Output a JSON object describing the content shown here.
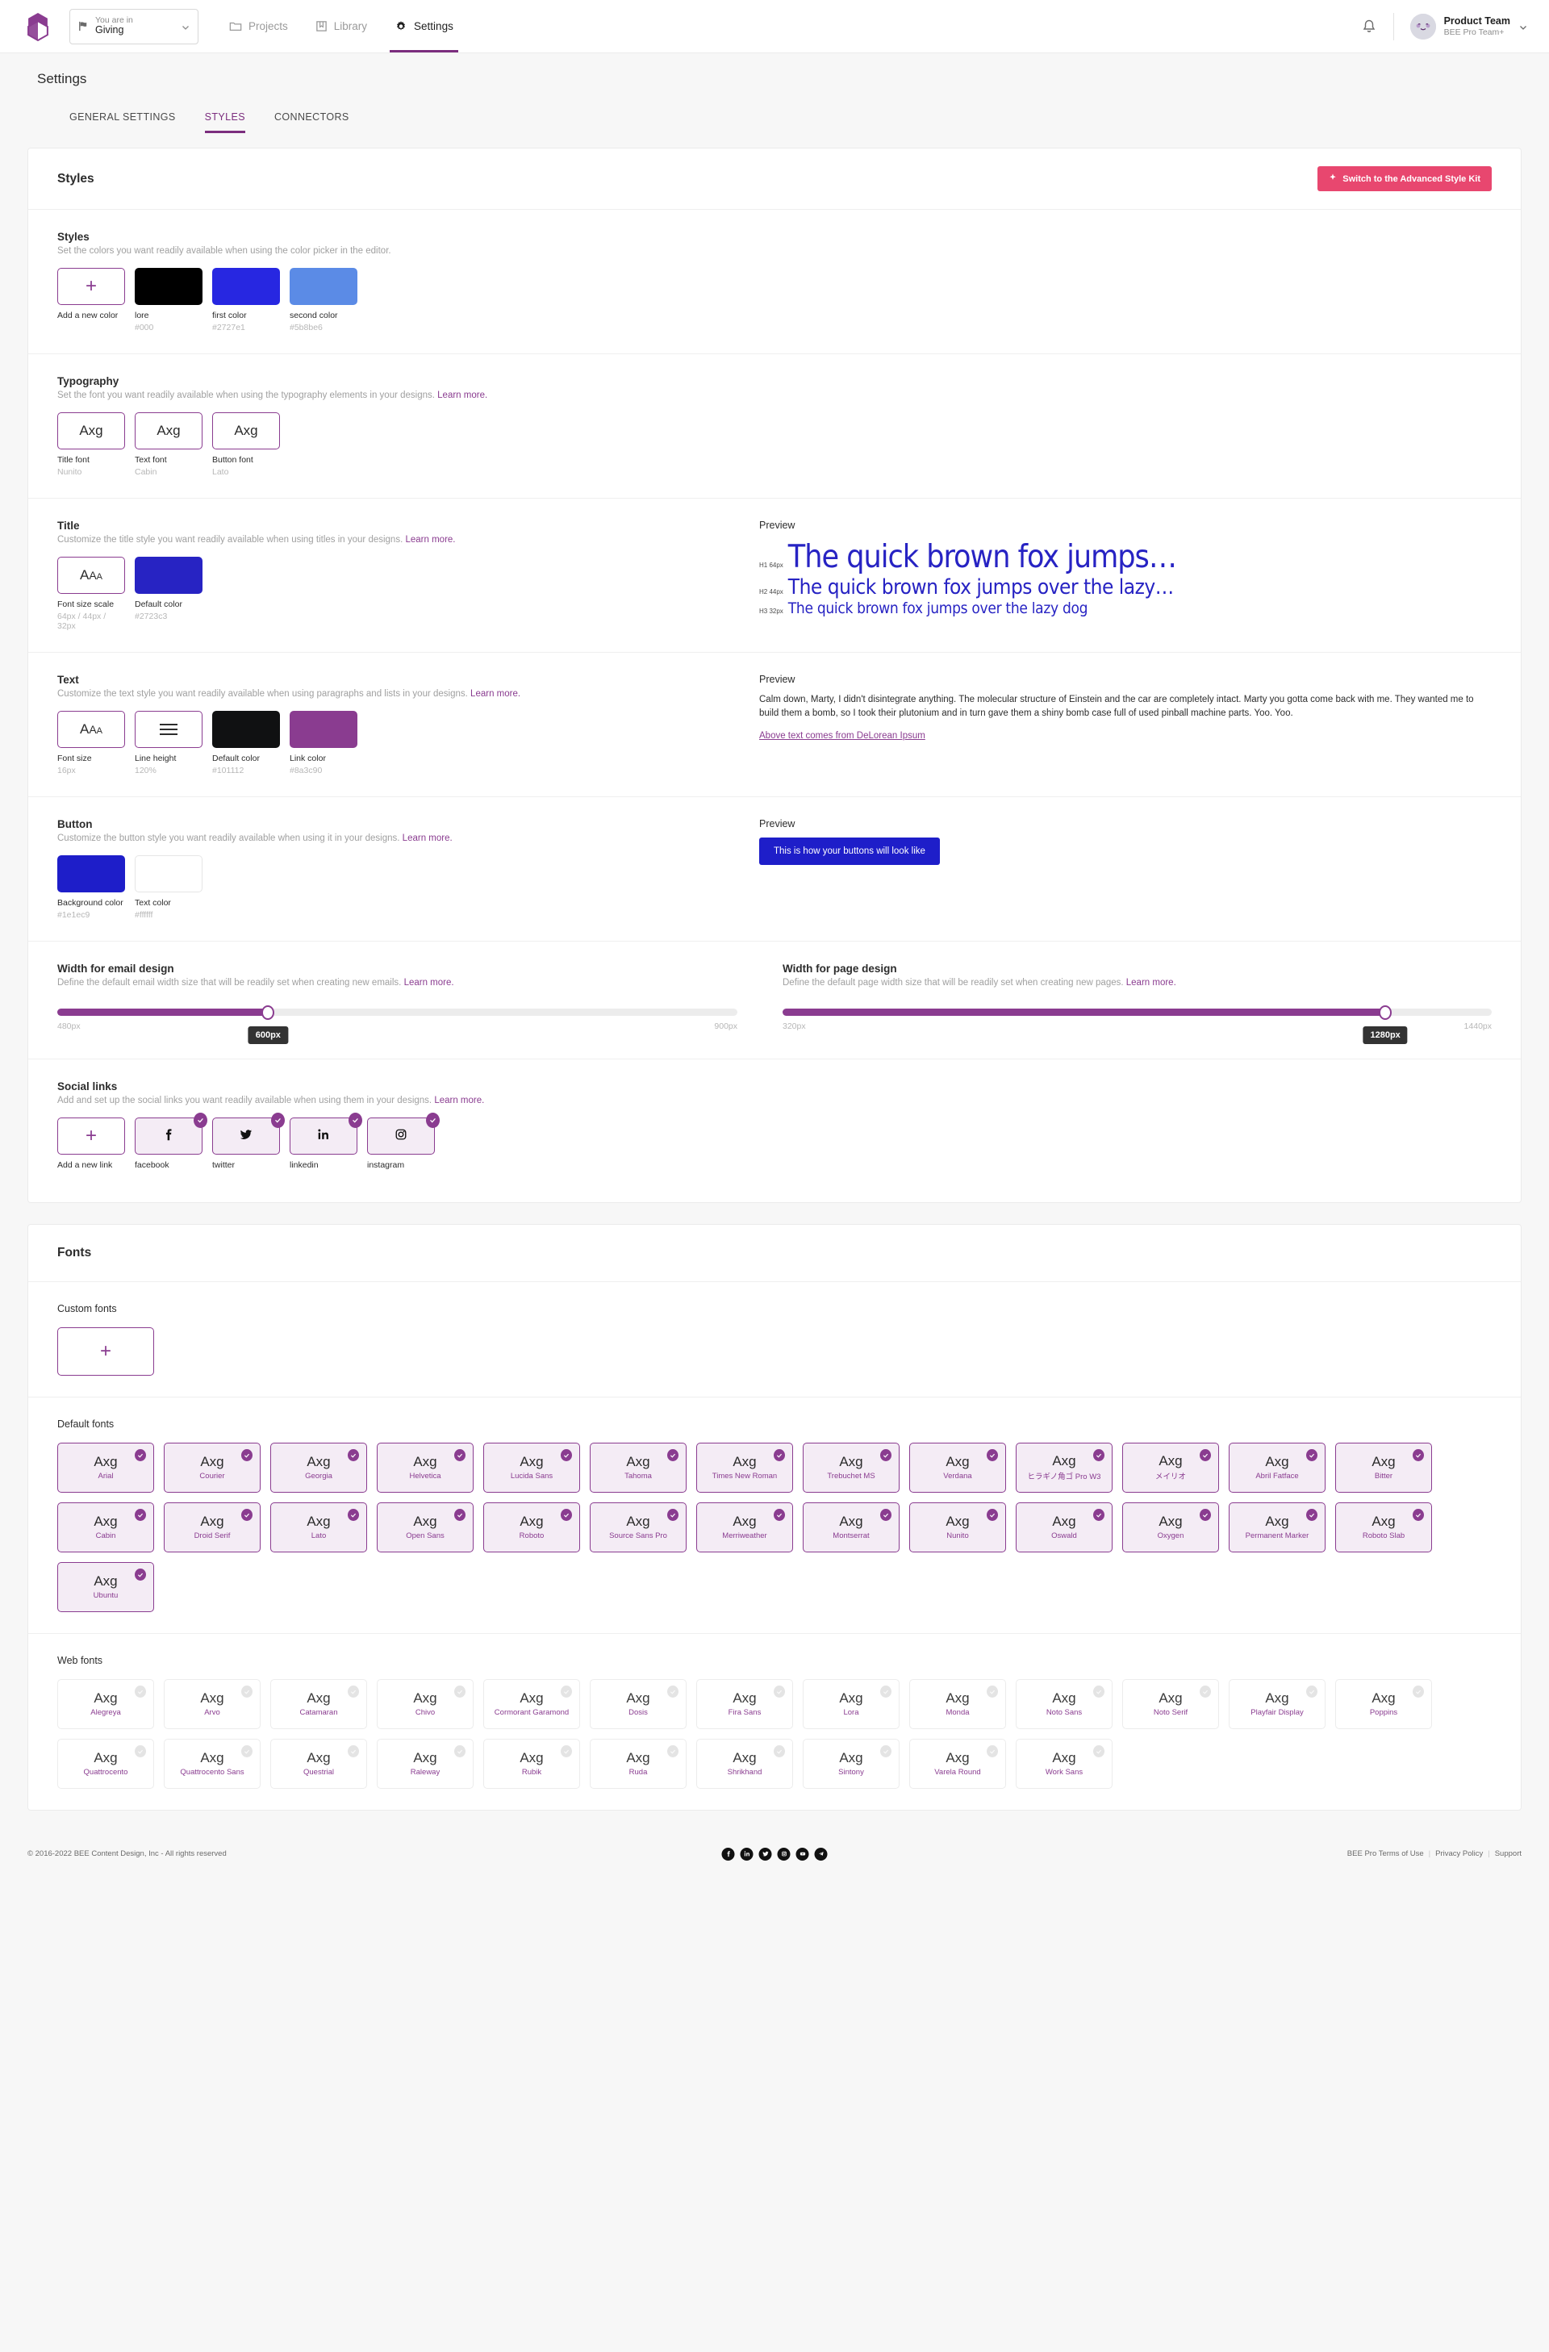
{
  "topbar": {
    "logo_icon": "bee-cubes-logo",
    "workspace": {
      "label": "You are in",
      "value": "Giving",
      "flag_icon": "flag-icon",
      "chevron_icon": "chevron-down-icon"
    },
    "nav": [
      {
        "label": "Projects",
        "icon": "folder-icon",
        "active": false
      },
      {
        "label": "Library",
        "icon": "book-icon",
        "active": false
      },
      {
        "label": "Settings",
        "icon": "gear-icon",
        "active": true
      }
    ],
    "bell_icon": "bell-icon",
    "user": {
      "name": "Product Team",
      "plan": "BEE Pro Team+",
      "avatar_icon": "avatar-face-icon",
      "chevron_icon": "chevron-down-icon"
    }
  },
  "page": {
    "title": "Settings",
    "tabs": [
      {
        "label": "GENERAL SETTINGS",
        "active": false
      },
      {
        "label": "STYLES",
        "active": true
      },
      {
        "label": "CONNECTORS",
        "active": false
      }
    ]
  },
  "styles_card": {
    "title": "Styles",
    "advanced_button": {
      "label": "Switch to the Advanced Style Kit",
      "icon": "sparkle-icon",
      "color": "#e8476f"
    },
    "colors": {
      "heading": "Styles",
      "description": "Set the colors you want readily available when using the color picker in the editor.",
      "add_label": "Add a new color",
      "add_icon": "plus-icon",
      "items": [
        {
          "name": "lore",
          "hex": "#000"
        },
        {
          "name": "first color",
          "hex": "#2727e1"
        },
        {
          "name": "second color",
          "hex": "#5b8be6"
        }
      ]
    },
    "typography": {
      "heading": "Typography",
      "description": "Set the font you want readily available when using the typography elements in your designs.",
      "learn_more": "Learn more.",
      "items": [
        {
          "sample": "Axg",
          "label": "Title font",
          "value": "Nunito"
        },
        {
          "sample": "Axg",
          "label": "Text font",
          "value": "Cabin"
        },
        {
          "sample": "Axg",
          "label": "Button font",
          "value": "Lato"
        }
      ]
    },
    "title_section": {
      "heading": "Title",
      "description": "Customize the title style you want readily available when using titles in your designs.",
      "learn_more": "Learn more.",
      "font_scale": {
        "label": "Font size scale",
        "value": "64px / 44px / 32px",
        "icon": "aaa-icon"
      },
      "default_color": {
        "label": "Default color",
        "value": "#2723c3"
      },
      "preview": {
        "heading": "Preview",
        "lines": [
          {
            "tag": "H1 64px",
            "text": "The quick brown fox jumps…"
          },
          {
            "tag": "H2 44px",
            "text": "The quick brown fox jumps over the lazy…"
          },
          {
            "tag": "H3 32px",
            "text": "The quick brown fox jumps over the lazy dog"
          }
        ]
      }
    },
    "text_section": {
      "heading": "Text",
      "description": "Customize the text style you want readily available when using paragraphs and lists in your designs.",
      "learn_more": "Learn more.",
      "font_size": {
        "label": "Font size",
        "value": "16px",
        "icon": "aaa-icon"
      },
      "line_height": {
        "label": "Line height",
        "value": "120%",
        "icon": "line-height-icon"
      },
      "default_color": {
        "label": "Default color",
        "value": "#101112"
      },
      "link_color": {
        "label": "Link color",
        "value": "#8a3c90"
      },
      "preview": {
        "heading": "Preview",
        "body": "Calm down, Marty, I didn't disintegrate anything. The molecular structure of Einstein and the car are completely intact. Marty you gotta come back with me. They wanted me to build them a bomb, so I took their plutonium and in turn gave them a shiny bomb case full of used pinball machine parts. Yoo. Yoo.",
        "link": "Above text comes from DeLorean Ipsum"
      }
    },
    "button_section": {
      "heading": "Button",
      "description": "Customize the button style you want readily available when using it in your designs.",
      "learn_more": "Learn more.",
      "background_color": {
        "label": "Background color",
        "value": "#1e1ec9"
      },
      "text_color": {
        "label": "Text color",
        "value": "#ffffff"
      },
      "preview": {
        "heading": "Preview",
        "button_label": "This is how your buttons will look like"
      }
    },
    "email_width": {
      "heading": "Width for email design",
      "description": "Define the default email width size that will be readily set when creating new emails.",
      "learn_more": "Learn more.",
      "min": "480px",
      "max": "900px",
      "value": "600px",
      "percent": 31
    },
    "page_width": {
      "heading": "Width for page design",
      "description": "Define the default page width size that will be readily set when creating new pages.",
      "learn_more": "Learn more.",
      "min": "320px",
      "max": "1440px",
      "value": "1280px",
      "percent": 85
    },
    "social": {
      "heading": "Social links",
      "description": "Add and set up the social links you want readily available when using them in your designs.",
      "learn_more": "Learn more.",
      "add_label": "Add a new link",
      "add_icon": "plus-icon",
      "items": [
        {
          "name": "facebook",
          "icon": "facebook-icon",
          "checked": true
        },
        {
          "name": "twitter",
          "icon": "twitter-icon",
          "checked": true
        },
        {
          "name": "linkedin",
          "icon": "linkedin-icon",
          "checked": true
        },
        {
          "name": "instagram",
          "icon": "instagram-icon",
          "checked": true
        }
      ]
    }
  },
  "fonts_card": {
    "title": "Fonts",
    "custom_fonts": {
      "heading": "Custom fonts",
      "add_icon": "plus-icon"
    },
    "default_fonts": {
      "heading": "Default fonts",
      "sample": "Axg",
      "items": [
        {
          "name": "Arial",
          "checked": true
        },
        {
          "name": "Courier",
          "checked": true
        },
        {
          "name": "Georgia",
          "checked": true
        },
        {
          "name": "Helvetica",
          "checked": true
        },
        {
          "name": "Lucida Sans",
          "checked": true
        },
        {
          "name": "Tahoma",
          "checked": true
        },
        {
          "name": "Times New Roman",
          "checked": true
        },
        {
          "name": "Trebuchet MS",
          "checked": true
        },
        {
          "name": "Verdana",
          "checked": true
        },
        {
          "name": "ヒラギノ角ゴ Pro W3",
          "checked": true
        },
        {
          "name": "メイリオ",
          "checked": true
        },
        {
          "name": "Abril Fatface",
          "checked": true
        },
        {
          "name": "Bitter",
          "checked": true
        },
        {
          "name": "Cabin",
          "checked": true
        },
        {
          "name": "Droid Serif",
          "checked": true
        },
        {
          "name": "Lato",
          "checked": true
        },
        {
          "name": "Open Sans",
          "checked": true
        },
        {
          "name": "Roboto",
          "checked": true
        },
        {
          "name": "Source Sans Pro",
          "checked": true
        },
        {
          "name": "Merriweather",
          "checked": true
        },
        {
          "name": "Montserrat",
          "checked": true
        },
        {
          "name": "Nunito",
          "checked": true
        },
        {
          "name": "Oswald",
          "checked": true
        },
        {
          "name": "Oxygen",
          "checked": true
        },
        {
          "name": "Permanent Marker",
          "checked": true
        },
        {
          "name": "Roboto Slab",
          "checked": true
        },
        {
          "name": "Ubuntu",
          "checked": true
        }
      ]
    },
    "web_fonts": {
      "heading": "Web fonts",
      "sample": "Axg",
      "items": [
        {
          "name": "Alegreya",
          "checked": false
        },
        {
          "name": "Arvo",
          "checked": false
        },
        {
          "name": "Catamaran",
          "checked": false
        },
        {
          "name": "Chivo",
          "checked": false
        },
        {
          "name": "Cormorant Garamond",
          "checked": false
        },
        {
          "name": "Dosis",
          "checked": false
        },
        {
          "name": "Fira Sans",
          "checked": false
        },
        {
          "name": "Lora",
          "checked": false
        },
        {
          "name": "Monda",
          "checked": false
        },
        {
          "name": "Noto Sans",
          "checked": false
        },
        {
          "name": "Noto Serif",
          "checked": false
        },
        {
          "name": "Playfair Display",
          "checked": false
        },
        {
          "name": "Poppins",
          "checked": false
        },
        {
          "name": "Quattrocento",
          "checked": false
        },
        {
          "name": "Quattrocento Sans",
          "checked": false
        },
        {
          "name": "Questrial",
          "checked": false
        },
        {
          "name": "Raleway",
          "checked": false
        },
        {
          "name": "Rubik",
          "checked": false
        },
        {
          "name": "Ruda",
          "checked": false
        },
        {
          "name": "Shrikhand",
          "checked": false
        },
        {
          "name": "Sintony",
          "checked": false
        },
        {
          "name": "Varela Round",
          "checked": false
        },
        {
          "name": "Work Sans",
          "checked": false
        }
      ]
    }
  },
  "footer": {
    "copyright": "© 2016-2022 BEE Content Design, Inc - All rights reserved",
    "social": [
      {
        "icon": "facebook-icon"
      },
      {
        "icon": "linkedin-icon"
      },
      {
        "icon": "twitter-icon"
      },
      {
        "icon": "instagram-icon"
      },
      {
        "icon": "youtube-icon"
      },
      {
        "icon": "telegram-icon"
      }
    ],
    "links": [
      {
        "label": "BEE Pro Terms of Use"
      },
      {
        "label": "Privacy Policy"
      },
      {
        "label": "Support"
      }
    ],
    "separator": "|"
  }
}
